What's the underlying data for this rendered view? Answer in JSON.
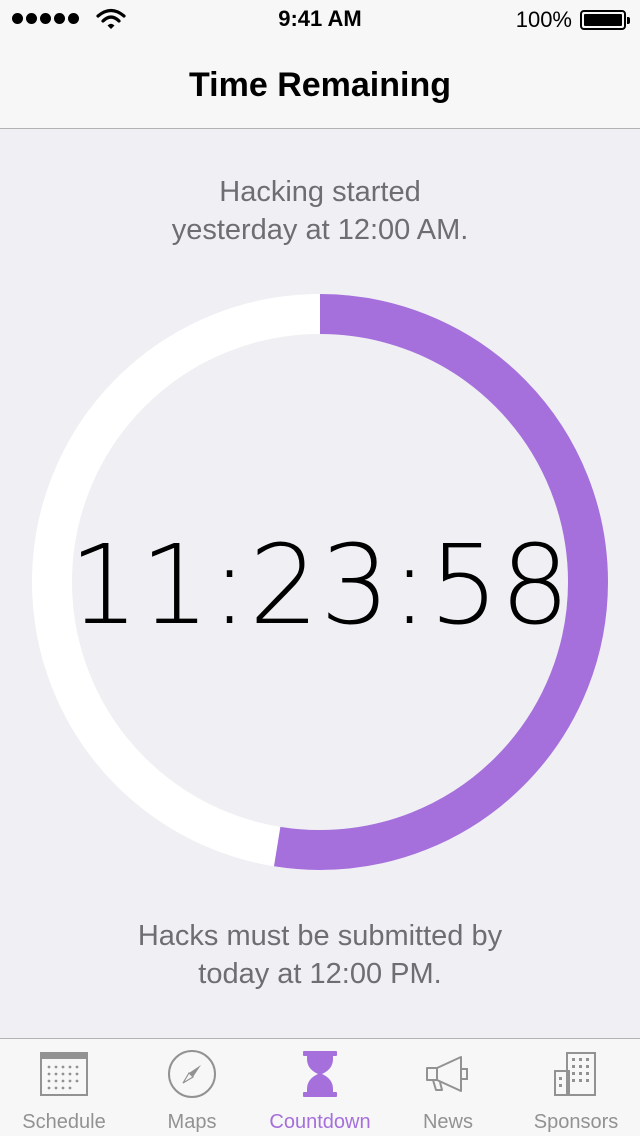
{
  "status_bar": {
    "time": "9:41 AM",
    "battery_percent": "100%",
    "signal_bars": 5
  },
  "nav": {
    "title": "Time Remaining"
  },
  "countdown": {
    "start_line1": "Hacking started",
    "start_line2": "yesterday at 12:00 AM.",
    "time_remaining": "11:23:58",
    "progress_fraction": 0.5255,
    "deadline_line1": "Hacks must be submitted by",
    "deadline_line2": "today at 12:00 PM."
  },
  "colors": {
    "accent": "#a56fdc",
    "background": "#efeff4",
    "ring_track": "#ffffff",
    "tab_inactive": "#929292"
  },
  "tabs": [
    {
      "label": "Schedule",
      "icon": "calendar-icon",
      "active": false
    },
    {
      "label": "Maps",
      "icon": "compass-icon",
      "active": false
    },
    {
      "label": "Countdown",
      "icon": "hourglass-icon",
      "active": true
    },
    {
      "label": "News",
      "icon": "megaphone-icon",
      "active": false
    },
    {
      "label": "Sponsors",
      "icon": "building-icon",
      "active": false
    }
  ]
}
